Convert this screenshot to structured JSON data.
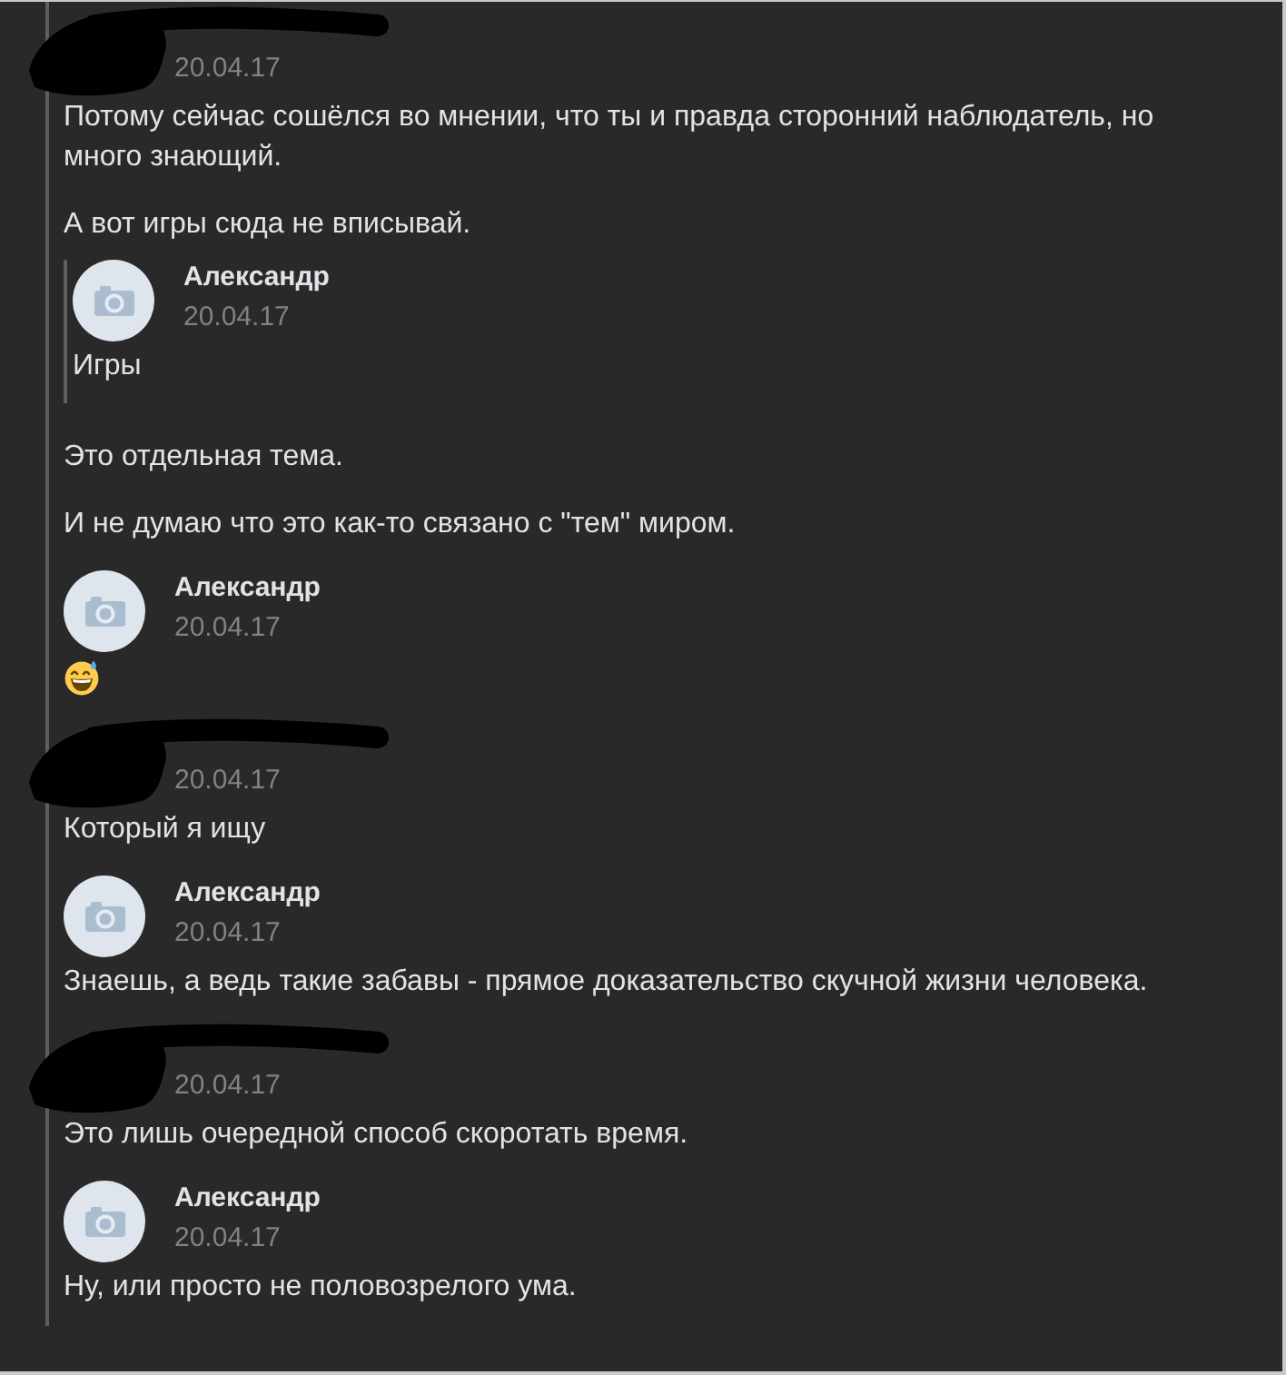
{
  "forwarded_messages": [
    {
      "redacted": true,
      "date": "20.04.17",
      "content": [
        {
          "kind": "text",
          "text": "Потому сейчас сошёлся во мнении, что ты и правда сторонний наблюдатель, но много знающий."
        },
        {
          "kind": "text",
          "text": "А вот игры сюда не вписывай."
        },
        {
          "kind": "forward",
          "redacted": false,
          "author": "Александр",
          "date": "20.04.17",
          "content": [
            {
              "kind": "text",
              "text": "Игры"
            }
          ]
        },
        {
          "kind": "text",
          "text": "Это отдельная тема."
        },
        {
          "kind": "text",
          "text": "И не думаю что это как-то связано с \"тем\" миром."
        }
      ]
    },
    {
      "redacted": false,
      "author": "Александр",
      "date": "20.04.17",
      "content": [
        {
          "kind": "emoji"
        }
      ]
    },
    {
      "redacted": true,
      "date": "20.04.17",
      "content": [
        {
          "kind": "text",
          "text": "Который я ищу"
        }
      ]
    },
    {
      "redacted": false,
      "author": "Александр",
      "date": "20.04.17",
      "content": [
        {
          "kind": "text",
          "text": "Знаешь, а ведь такие забавы - прямое доказательство скучной жизни человека."
        }
      ]
    },
    {
      "redacted": true,
      "date": "20.04.17",
      "content": [
        {
          "kind": "text",
          "text": "Это лишь очередной способ скоротать время."
        }
      ]
    },
    {
      "redacted": false,
      "author": "Александр",
      "date": "20.04.17",
      "content": [
        {
          "kind": "text",
          "text": "Ну, или просто не половозрелого ума."
        }
      ]
    }
  ]
}
